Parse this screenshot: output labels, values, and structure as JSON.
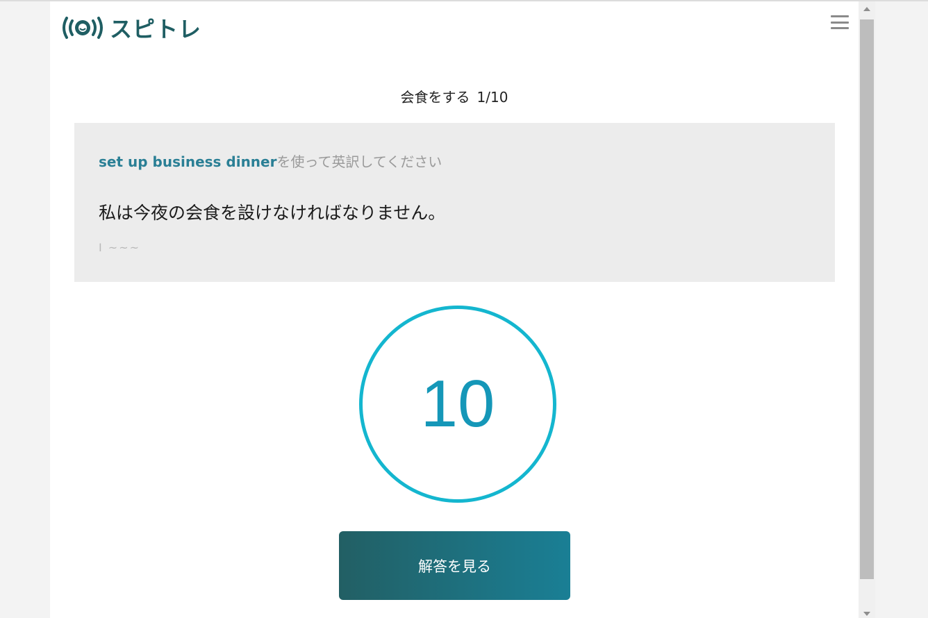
{
  "app": {
    "logo_text": "スピトレ",
    "logo_icon": "sound-wave-face-icon",
    "menu_icon": "hamburger-menu-icon"
  },
  "lesson": {
    "topic": "会食をする",
    "progress": "1/10",
    "current": 1,
    "total": 10
  },
  "question": {
    "phrase": "set up business dinner",
    "instruction_suffix": "を使って英訳してください",
    "japanese": "私は今夜の会食を設けなければなりません。",
    "hint": "I ~~~"
  },
  "timer": {
    "seconds": "10"
  },
  "actions": {
    "show_answer_label": "解答を見る"
  },
  "colors": {
    "brand": "#1f5e63",
    "accent": "#14b6cf",
    "phrase": "#2a7f95",
    "button_start": "#225f64",
    "button_end": "#1a7f95"
  }
}
